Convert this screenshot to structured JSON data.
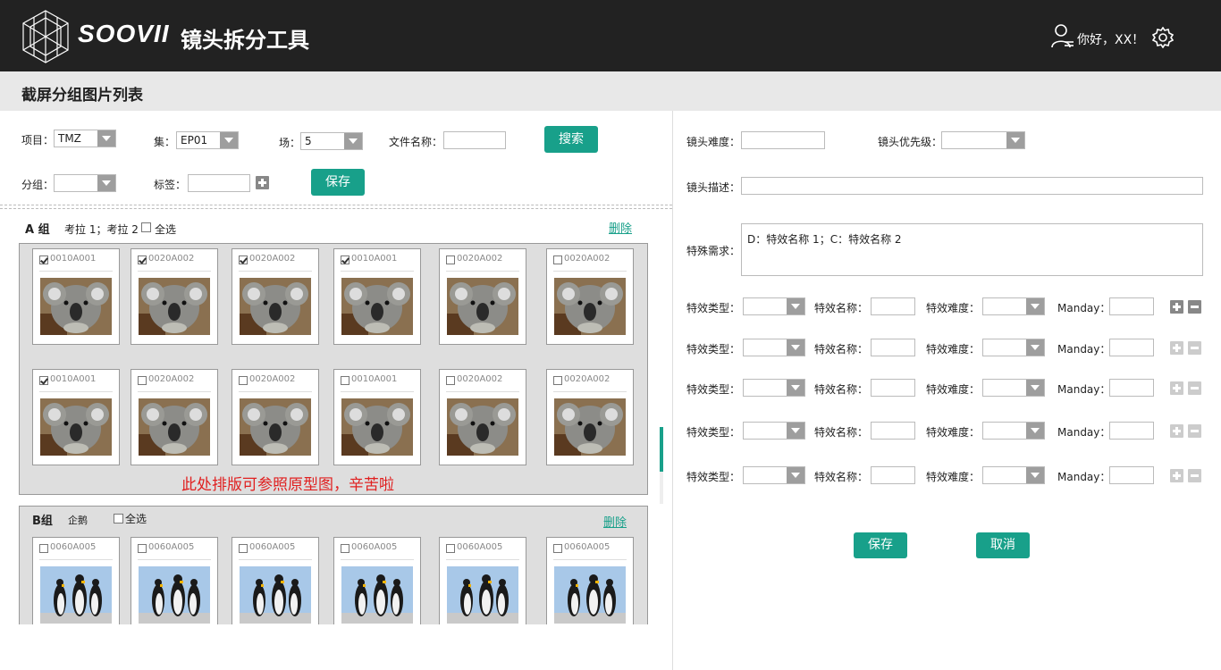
{
  "header": {
    "brand": "SOOVII",
    "app_title": "镜头拆分工具",
    "greeting": "你好，XX！"
  },
  "page_title": "截屏分组图片列表",
  "filters": {
    "project_label": "项目：",
    "project_value": "TMZ",
    "episode_label": "集：",
    "episode_value": "EP01",
    "scene_label": "场：",
    "scene_value": "5",
    "filename_label": "文件名称：",
    "filename_value": "",
    "search_label": "搜索",
    "group_label": "分组：",
    "group_value": "",
    "tag_label": "标签：",
    "tag_value": "",
    "save_label": "保存"
  },
  "groups": [
    {
      "name": "A 组",
      "tags": "考拉 1；考拉 2",
      "select_all": "全选",
      "delete": "删除",
      "cards": [
        {
          "name": "0010A001",
          "checked": true
        },
        {
          "name": "0020A002",
          "checked": true
        },
        {
          "name": "0020A002",
          "checked": true
        },
        {
          "name": "0010A001",
          "checked": true
        },
        {
          "name": "0020A002",
          "checked": false
        },
        {
          "name": "0020A002",
          "checked": false
        },
        {
          "name": "0010A001",
          "checked": true
        },
        {
          "name": "0020A002",
          "checked": false
        },
        {
          "name": "0020A002",
          "checked": false
        },
        {
          "name": "0010A001",
          "checked": false
        },
        {
          "name": "0020A002",
          "checked": false
        },
        {
          "name": "0020A002",
          "checked": false
        }
      ]
    },
    {
      "name": "B组",
      "tags": "企鹅",
      "select_all": "全选",
      "delete": "删除",
      "cards": [
        {
          "name": "0060A005",
          "checked": false
        },
        {
          "name": "0060A005",
          "checked": false
        },
        {
          "name": "0060A005",
          "checked": false
        },
        {
          "name": "0060A005",
          "checked": false
        },
        {
          "name": "0060A005",
          "checked": false
        },
        {
          "name": "0060A005",
          "checked": false
        }
      ]
    }
  ],
  "layout_note": "此处排版可参照原型图，辛苦啦",
  "detail": {
    "difficulty_label": "镜头难度：",
    "difficulty_value": "",
    "priority_label": "镜头优先级：",
    "priority_value": "",
    "description_label": "镜头描述：",
    "description_value": "",
    "special_label": "特殊需求：",
    "special_value": "D：特效名称 1；C：特效名称 2",
    "fx_type_label": "特效类型：",
    "fx_name_label": "特效名称：",
    "fx_difficulty_label": "特效难度：",
    "manday_label": "Manday：",
    "save_label": "保存",
    "cancel_label": "取消"
  },
  "colors": {
    "accent": "#18a08a",
    "header_bg": "#222222",
    "warning_text": "#e02020"
  }
}
